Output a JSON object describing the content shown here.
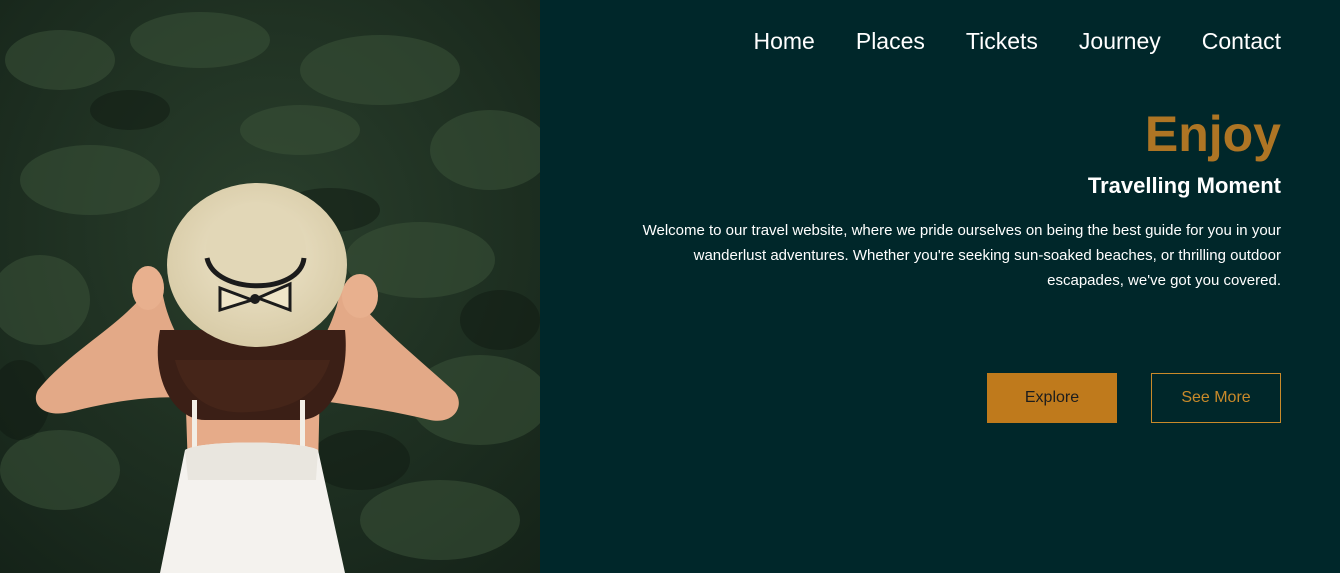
{
  "nav": {
    "items": [
      {
        "label": "Home"
      },
      {
        "label": "Places"
      },
      {
        "label": "Tickets"
      },
      {
        "label": "Journey"
      },
      {
        "label": "Contact"
      }
    ]
  },
  "hero": {
    "title": "Enjoy",
    "subtitle": "Travelling Moment",
    "description": "Welcome to our travel website, where we pride ourselves on being the best guide for you in your wanderlust adventures. Whether you're seeking sun-soaked beaches, or thrilling outdoor escapades, we've got you covered.",
    "explore_label": "Explore",
    "see_more_label": "See More"
  },
  "colors": {
    "background": "#00272a",
    "accent": "#bf7a1c",
    "title": "#ae7524",
    "text": "#ffffff"
  }
}
